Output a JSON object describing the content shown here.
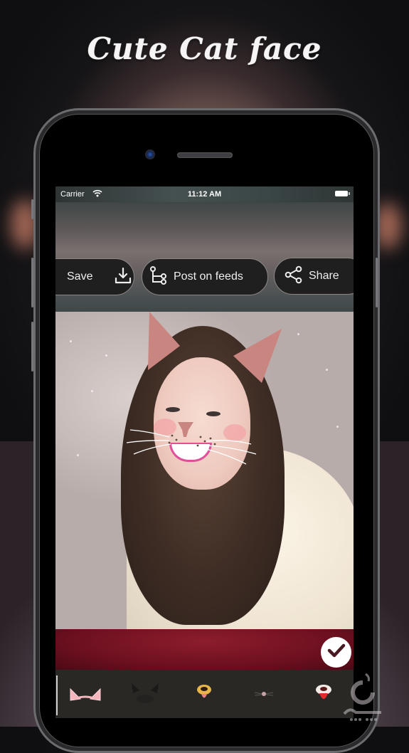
{
  "promo": {
    "headline": "Cute Cat face"
  },
  "status_bar": {
    "carrier": "Carrier",
    "time": "11:12 AM",
    "wifi_icon": "wifi-icon",
    "battery_icon": "battery-icon"
  },
  "toolbar": {
    "save_label": "Save",
    "save_icon": "download-icon",
    "post_label": "Post on feeds",
    "post_icon": "branch-icon",
    "share_label": "Share",
    "share_icon": "share-icon"
  },
  "editor": {
    "photo_description": "Smiling woman in a white fur coat in snow, with pink cat-ear, cat-nose and whisker overlay",
    "confirm_icon": "checkmark-icon"
  },
  "sticker_tray": {
    "items": [
      {
        "name": "pink-cat-ears",
        "icon": "cat-ears-icon"
      },
      {
        "name": "black-cat-face",
        "icon": "cat-face-icon"
      },
      {
        "name": "dog-nose-tongue",
        "icon": "dog-nose-icon"
      },
      {
        "name": "cat-nose-whiskers",
        "icon": "whiskers-icon"
      },
      {
        "name": "dog-mouth-tongue",
        "icon": "dog-mouth-icon"
      }
    ]
  },
  "colors": {
    "pill_bg": "#201f1f",
    "cat_ear": "#c9857f",
    "accent_strip": "#6e1020",
    "tray_bg": "#2a2825"
  }
}
